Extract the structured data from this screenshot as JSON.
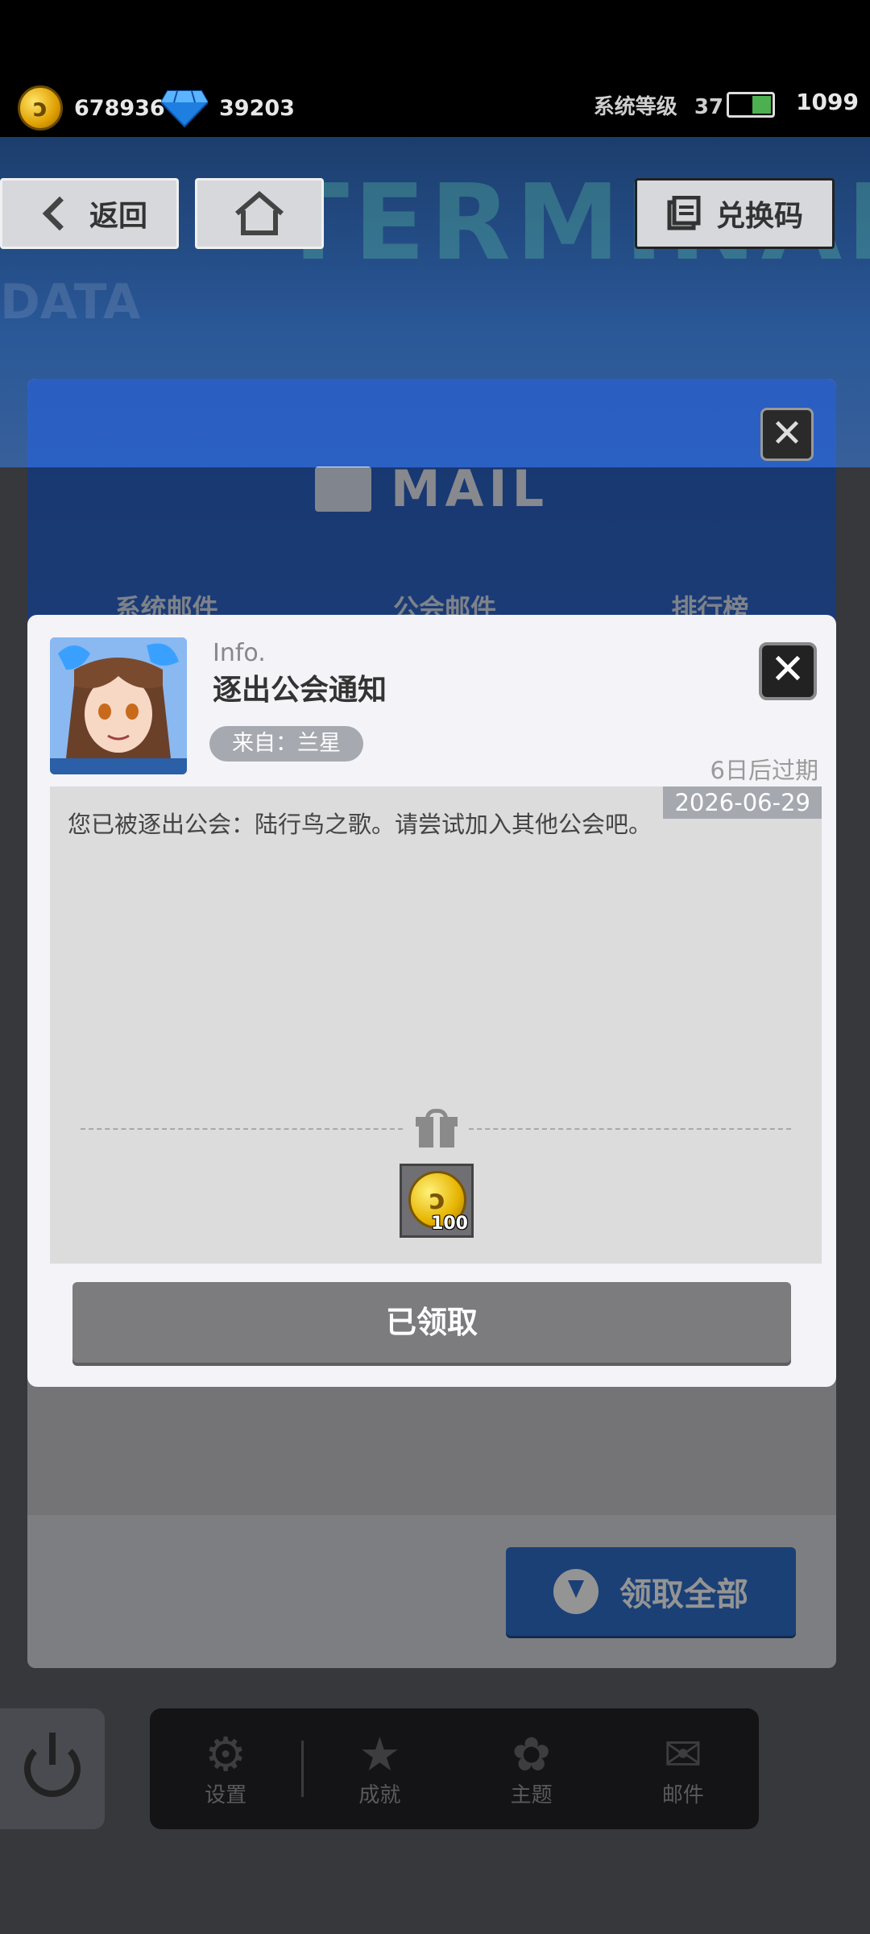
{
  "status": {
    "gold": "678936",
    "gems": "39203",
    "level_label": "系统等级",
    "level_value": "37",
    "energy": "1099",
    "battery_level": 0.45
  },
  "header": {
    "back_label": "返回",
    "redeem_label": "兑换码",
    "deco_word": "TERMINAL",
    "deco_data": "DATA"
  },
  "mail": {
    "title": "MAIL",
    "tabs": [
      "系统邮件",
      "公会邮件",
      "排行榜"
    ],
    "claim_all_label": "领取全部"
  },
  "message": {
    "info_tag": "Info.",
    "title": "逐出公会通知",
    "from": "来自：兰星",
    "expire": "6日后过期",
    "date": "2026-06-29",
    "body": "您已被逐出公会：陆行鸟之歌。请尝试加入其他公会吧。",
    "reward_qty": "100",
    "claimed_label": "已领取"
  },
  "bottom_nav": {
    "items": [
      {
        "label": "设置",
        "icon": "gear-icon"
      },
      {
        "label": "成就",
        "icon": "trophy-icon"
      },
      {
        "label": "主题",
        "icon": "flower-icon"
      },
      {
        "label": "邮件",
        "icon": "mail-icon"
      }
    ]
  },
  "colors": {
    "accent_blue": "#2f6fcb",
    "dialog_bg": "#f3f3f8",
    "claimed_gray": "#7c7c7e"
  }
}
